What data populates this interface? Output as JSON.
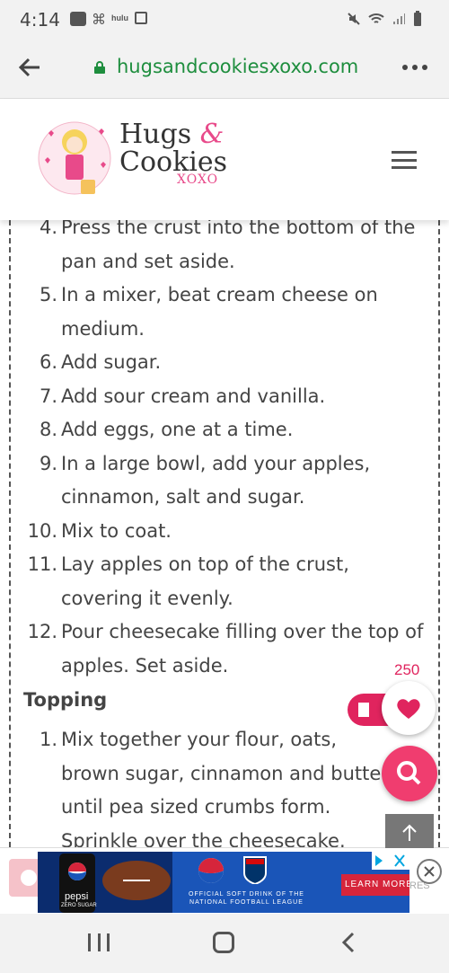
{
  "status": {
    "time": "4:14",
    "app_icons": [
      "hulu-icon",
      "slack-icon",
      "hulu-icon",
      "image-icon"
    ],
    "app_icon_labels": [
      "hulu",
      "hulu"
    ],
    "right_icons": [
      "mute-icon",
      "wifi-icon",
      "signal-icon",
      "battery-icon"
    ]
  },
  "browser": {
    "url": "hugsandcookiesxoxo.com",
    "accent": "#1e8e3e"
  },
  "site": {
    "logo_line1": "Hugs",
    "logo_amp": "&",
    "logo_line2": "Cookies",
    "logo_line3": "XOXO"
  },
  "recipe": {
    "steps": [
      {
        "num": "4.",
        "text": "Press the crust into the bottom of the pan and set aside."
      },
      {
        "num": "5.",
        "text": "In a mixer, beat cream cheese on medium."
      },
      {
        "num": "6.",
        "text": "Add sugar."
      },
      {
        "num": "7.",
        "text": "Add sour cream and vanilla."
      },
      {
        "num": "8.",
        "text": "Add eggs, one at a time."
      },
      {
        "num": "9.",
        "text": "In a large bowl, add your apples, cinnamon, salt and sugar."
      },
      {
        "num": "10.",
        "text": "Mix to coat."
      },
      {
        "num": "11.",
        "text": "Lay apples on top of the crust, covering it evenly."
      },
      {
        "num": "12.",
        "text": "Pour cheesecake filling over the top of apples. Set aside."
      }
    ],
    "topping_title": "Topping",
    "topping_steps": [
      {
        "num": "1.",
        "text": "Mix together your flour, oats, brown sugar, cinnamon and butter until pea sized crumbs form. Sprinkle over the cheesecake."
      }
    ]
  },
  "floating": {
    "heart_count": "250",
    "accent": "#e0245e"
  },
  "ad": {
    "brand": "pepsi",
    "tagline": "ZERO SUGAR",
    "nfl_text_line1": "OFFICIAL SOFT DRINK OF THE",
    "nfl_text_line2": "NATIONAL FOOTBALL LEAGUE",
    "cta": "LEARN MORE",
    "behind_text": "RES"
  }
}
